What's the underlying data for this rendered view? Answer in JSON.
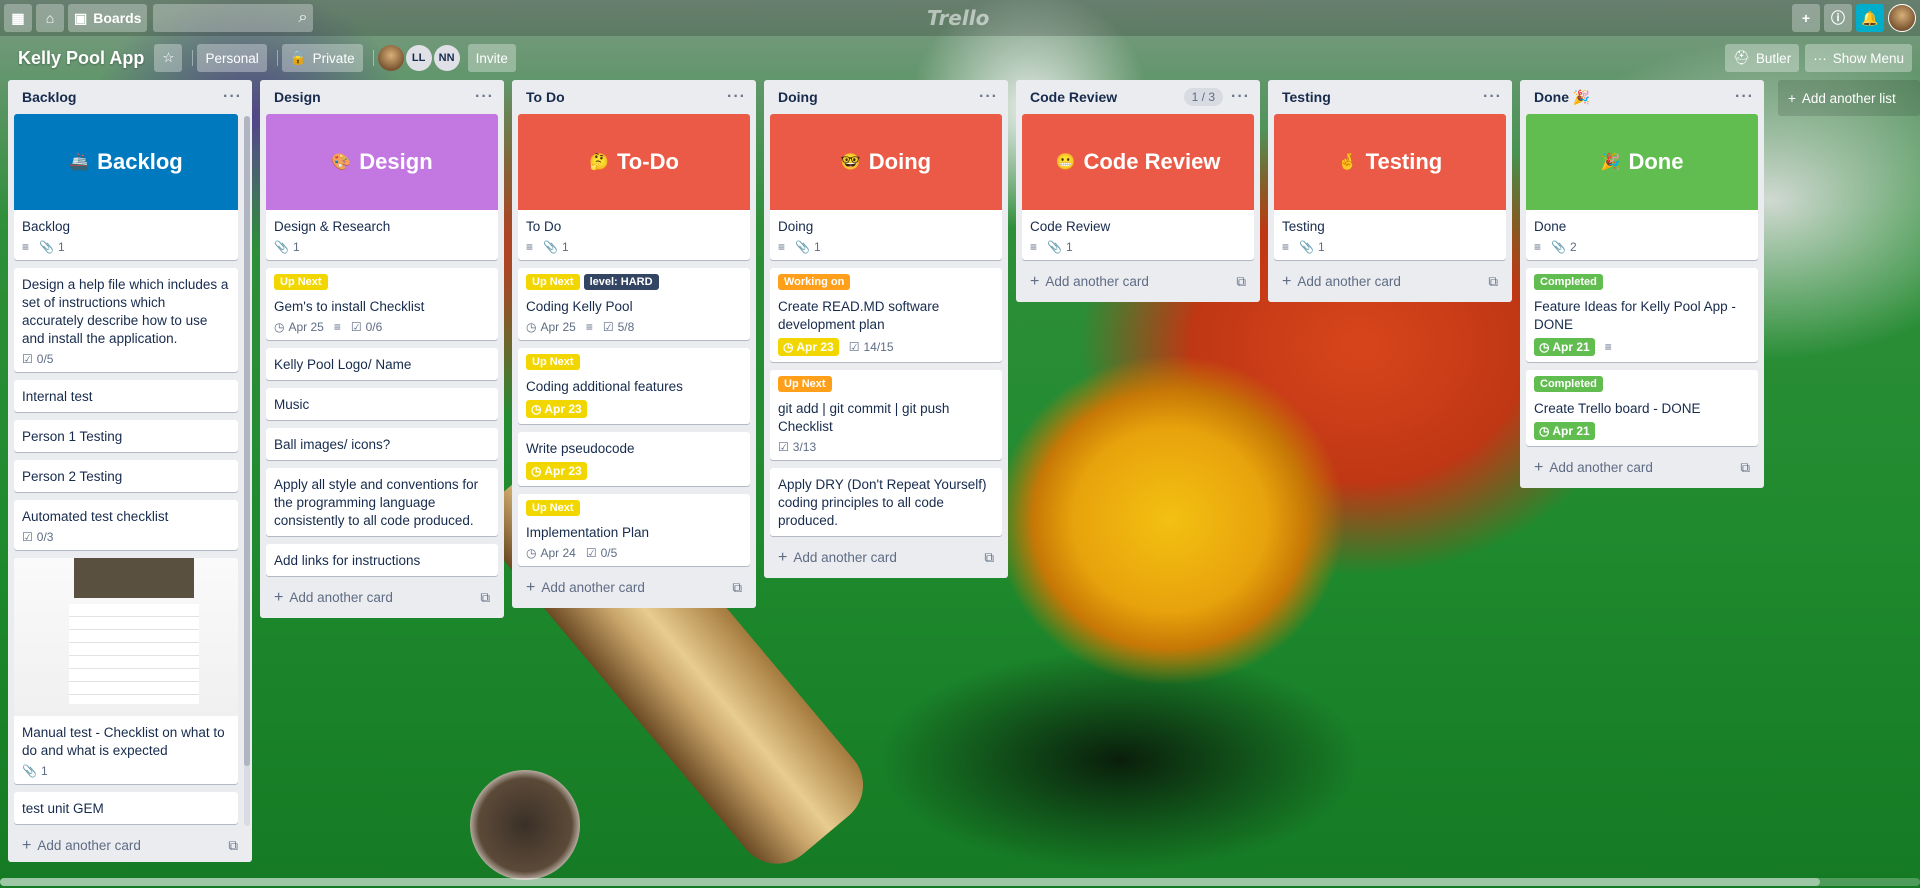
{
  "header": {
    "boards_label": "Boards",
    "logo": "Trello",
    "icons": [
      "apps-grid-icon",
      "home-icon",
      "boards-icon",
      "search-icon",
      "plus-icon",
      "info-icon",
      "bell-icon",
      "avatar"
    ]
  },
  "board": {
    "title": "Kelly Pool App",
    "visibility_team": "Personal",
    "visibility": "Private",
    "members": [
      "LL",
      "NN"
    ],
    "invite": "Invite",
    "butler": "Butler",
    "show_menu": "Show Menu"
  },
  "add_another_card": "Add another card",
  "add_another_list": "Add another list",
  "lists": [
    {
      "title": "Backlog",
      "cover": {
        "emoji": "🚢",
        "text": "Backlog",
        "color": "#0079bf"
      },
      "cover_card": {
        "title": "Backlog",
        "attachments": "1"
      },
      "cards": [
        {
          "title": "Design a help file which includes a set of instructions which accurately describe how to use and install the application.",
          "checklist": "0/5"
        },
        {
          "title": "Internal test"
        },
        {
          "title": "Person 1 Testing"
        },
        {
          "title": "Person 2 Testing"
        },
        {
          "title": "Automated test checklist",
          "checklist": "0/3"
        },
        {
          "title": "Manual test - Checklist on what to do and what is expected",
          "attachments": "1"
        },
        {
          "title": "test unit GEM"
        }
      ]
    },
    {
      "title": "Design",
      "cover": {
        "emoji": "🎨",
        "text": "Design",
        "color": "#c377e0"
      },
      "cover_card": {
        "title": "Design & Research",
        "attachments": "1"
      },
      "cards": [
        {
          "label": "Up Next",
          "title": "Gem's to install Checklist",
          "date": "Apr 25",
          "checklist": "0/6"
        },
        {
          "title": "Kelly Pool Logo/ Name"
        },
        {
          "title": "Music"
        },
        {
          "title": "Ball images/ icons?"
        },
        {
          "title": "Apply all style and conventions for the programming language consistently to all code produced."
        },
        {
          "title": "Add links for instructions"
        }
      ]
    },
    {
      "title": "To Do",
      "cover": {
        "emoji": "🤔",
        "text": "To-Do",
        "color": "#eb5a46"
      },
      "cover_card": {
        "title": "To Do",
        "attachments": "1"
      },
      "cards": [
        {
          "label": "Up Next",
          "label2": "level: HARD",
          "title": "Coding Kelly Pool",
          "date": "Apr 25",
          "checklist": "5/8"
        },
        {
          "label": "Up Next",
          "title": "Coding additional features",
          "due": "Apr 23"
        },
        {
          "title": "Write pseudocode",
          "due": "Apr 23"
        },
        {
          "label": "Up Next",
          "title": "Implementation Plan",
          "date": "Apr 24",
          "checklist": "0/5"
        }
      ]
    },
    {
      "title": "Doing",
      "cover": {
        "emoji": "🤓",
        "text": "Doing",
        "color": "#eb5a46"
      },
      "cover_card": {
        "title": "Doing",
        "attachments": "1"
      },
      "cards": [
        {
          "label": "Working on",
          "title": "Create READ.MD software development plan",
          "due": "Apr 23",
          "checklist": "14/15"
        },
        {
          "label": "Up Next",
          "title": "git add | git commit | git push Checklist",
          "checklist": "3/13"
        },
        {
          "title": "Apply DRY (Don't Repeat Yourself) coding principles to all code produced."
        }
      ]
    },
    {
      "title": "Code Review",
      "count": "1 / 3",
      "cover": {
        "emoji": "😬",
        "text": "Code Review",
        "color": "#eb5a46"
      },
      "cover_card": {
        "title": "Code Review",
        "attachments": "1"
      },
      "cards": []
    },
    {
      "title": "Testing",
      "cover": {
        "emoji": "🤞",
        "text": "Testing",
        "color": "#eb5a46"
      },
      "cover_card": {
        "title": "Testing",
        "attachments": "1"
      },
      "cards": []
    },
    {
      "title": "Done 🎉",
      "cover": {
        "emoji": "🎉",
        "text": "Done",
        "color": "#61bd4f"
      },
      "cover_card": {
        "title": "Done",
        "attachments": "2"
      },
      "cards": [
        {
          "label": "Completed",
          "title": "Feature Ideas for Kelly Pool App - DONE",
          "due": "Apr 21"
        },
        {
          "label": "Completed",
          "title": "Create Trello board - DONE",
          "due": "Apr 21"
        }
      ]
    }
  ]
}
